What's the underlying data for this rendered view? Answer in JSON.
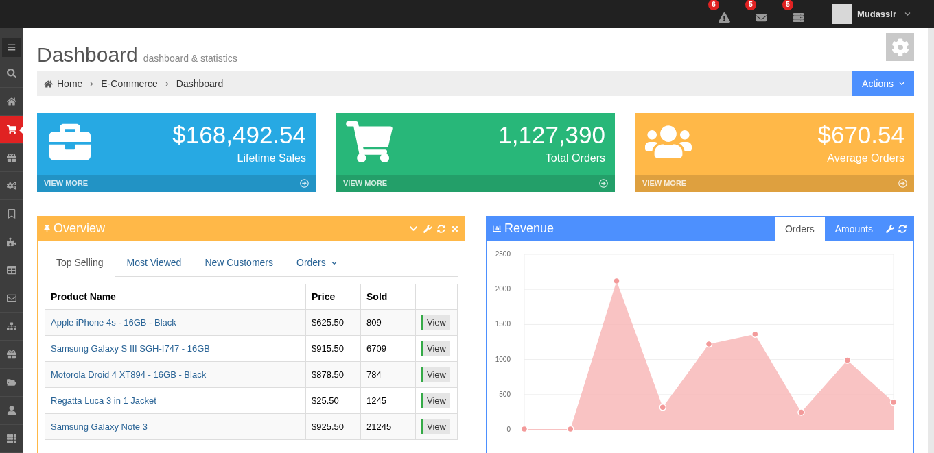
{
  "topbar": {
    "notifications": [
      {
        "kind": "alert",
        "count": "6"
      },
      {
        "kind": "mail",
        "count": "5"
      },
      {
        "kind": "tasks",
        "count": "5"
      }
    ],
    "user": {
      "name": "Mudassir"
    }
  },
  "sidebar": {
    "items": [
      {
        "kind": "search",
        "selected": false
      },
      {
        "kind": "home",
        "selected": false
      },
      {
        "kind": "cart",
        "selected": true
      },
      {
        "kind": "gift",
        "selected": false
      },
      {
        "kind": "gears",
        "selected": false
      },
      {
        "kind": "bookmark",
        "selected": false
      },
      {
        "kind": "puzzle",
        "selected": false
      },
      {
        "kind": "table",
        "selected": false
      },
      {
        "kind": "mail",
        "selected": false
      },
      {
        "kind": "sitemap",
        "selected": false
      },
      {
        "kind": "gift",
        "selected": false
      },
      {
        "kind": "folder",
        "selected": false
      },
      {
        "kind": "user",
        "selected": false
      },
      {
        "kind": "grid",
        "selected": false
      }
    ]
  },
  "page": {
    "title": "Dashboard",
    "subtitle": "dashboard & statistics"
  },
  "breadcrumb": {
    "items": [
      "Home",
      "E-Commerce",
      "Dashboard"
    ],
    "actions": "Actions"
  },
  "stats": [
    {
      "kind": "briefcase",
      "value": "$168,492.54",
      "label": "Lifetime Sales",
      "link": "VIEW MORE",
      "color": "#27a9e3"
    },
    {
      "kind": "cart",
      "value": "1,127,390",
      "label": "Total Orders",
      "link": "VIEW MORE",
      "color": "#28b779"
    },
    {
      "kind": "users",
      "value": "$670.54",
      "label": "Average Orders",
      "link": "VIEW MORE",
      "color": "#ffb848"
    }
  ],
  "overview": {
    "title": "Overview",
    "tabs": [
      {
        "label": "Top Selling",
        "selected": true,
        "dropdown": false
      },
      {
        "label": "Most Viewed",
        "selected": false,
        "dropdown": false
      },
      {
        "label": "New Customers",
        "selected": false,
        "dropdown": false
      },
      {
        "label": "Orders",
        "selected": false,
        "dropdown": true
      }
    ],
    "table": {
      "columns": [
        "Product Name",
        "Price",
        "Sold"
      ],
      "rows": [
        {
          "name": "Apple iPhone 4s - 16GB - Black",
          "price": "$625.50",
          "sold": "809",
          "action": "View"
        },
        {
          "name": "Samsung Galaxy S III SGH-I747 - 16GB",
          "price": "$915.50",
          "sold": "6709",
          "action": "View"
        },
        {
          "name": "Motorola Droid 4 XT894 - 16GB - Black",
          "price": "$878.50",
          "sold": "784",
          "action": "View"
        },
        {
          "name": "Regatta Luca 3 in 1 Jacket",
          "price": "$25.50",
          "sold": "1245",
          "action": "View"
        },
        {
          "name": "Samsung Galaxy Note 3",
          "price": "$925.50",
          "sold": "21245",
          "action": "View"
        }
      ]
    }
  },
  "revenue": {
    "title": "Revenue",
    "tabs": [
      {
        "label": "Orders",
        "selected": true
      },
      {
        "label": "Amounts",
        "selected": false
      }
    ],
    "chart_data": {
      "type": "area",
      "grid": true,
      "ylim": [
        0,
        2500
      ],
      "yticks": [
        0,
        500,
        1000,
        1500,
        2000,
        2500
      ],
      "series": [
        {
          "color": "#f8b4b4",
          "values": [
            10,
            10,
            2120,
            320,
            1220,
            1360,
            250,
            990,
            390
          ]
        }
      ]
    }
  }
}
